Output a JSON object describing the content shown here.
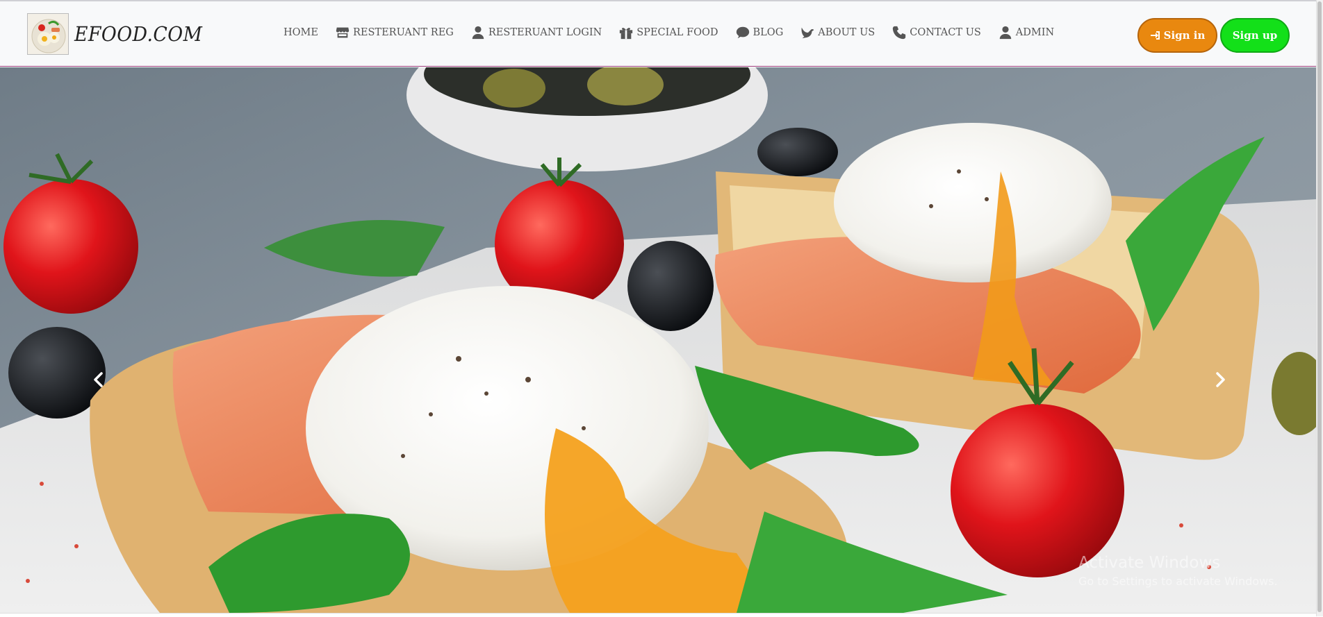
{
  "brand": {
    "name": "EFOOD.COM",
    "logo_icon": "food-plate-icon"
  },
  "nav": {
    "items": [
      {
        "label": "HOME",
        "icon": ""
      },
      {
        "label": "RESTERUANT REG",
        "icon": "store-icon"
      },
      {
        "label": "RESTERUANT LOGIN",
        "icon": "user-icon"
      },
      {
        "label": "SPECIAL FOOD",
        "icon": "gift-icon"
      },
      {
        "label": "BLOG",
        "icon": "comment-icon"
      },
      {
        "label": "ABOUT US",
        "icon": "dove-icon"
      },
      {
        "label": "CONTACT US",
        "icon": "phone-icon"
      },
      {
        "label": "ADMIN",
        "icon": "user-icon"
      }
    ]
  },
  "auth": {
    "signin_label": "Sign in",
    "signin_icon": "sign-in-icon",
    "signup_label": "Sign up"
  },
  "colors": {
    "signin_bg": "#e9880f",
    "signup_bg": "#13e019",
    "navbar_bg": "#f8f9fa",
    "navbar_border": "#9b3a7a"
  },
  "hero": {
    "image": "poached eggs with salmon on toast, tomatoes, olives and arugula",
    "prev_icon": "chevron-left-icon",
    "next_icon": "chevron-right-icon"
  },
  "watermark": {
    "title": "Activate Windows",
    "subtitle": "Go to Settings to activate Windows."
  }
}
